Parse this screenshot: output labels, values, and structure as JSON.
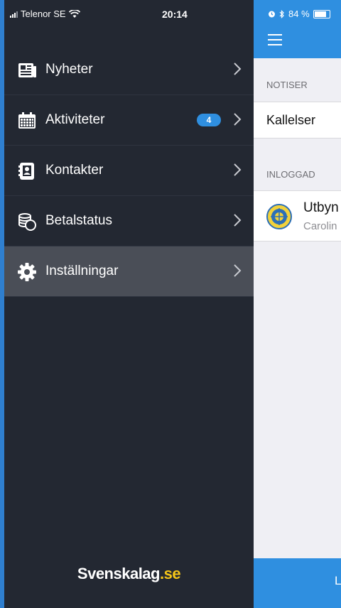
{
  "status_bar": {
    "carrier": "Telenor SE",
    "time": "20:14",
    "battery_text": "84 %"
  },
  "drawer": {
    "items": [
      {
        "label": "Nyheter",
        "icon": "newspaper-icon"
      },
      {
        "label": "Aktiviteter",
        "icon": "calendar-icon",
        "badge": "4"
      },
      {
        "label": "Kontakter",
        "icon": "contacts-icon"
      },
      {
        "label": "Betalstatus",
        "icon": "coins-icon"
      },
      {
        "label": "Inställningar",
        "icon": "gear-icon",
        "active": true
      }
    ],
    "brand_name": "Svenskalag",
    "brand_tld": ".se"
  },
  "panel": {
    "section_notiser": "NOTISER",
    "row_kallelser": "Kallelser",
    "section_inloggad": "INLOGGAD",
    "club_name": "Utbyn",
    "user_name": "Carolin",
    "bottom_button": "L"
  },
  "colors": {
    "accent_blue": "#2f8fe0",
    "drawer_bg": "#232832",
    "active_row": "#4a4e57",
    "brand_tld": "#f5c518"
  }
}
